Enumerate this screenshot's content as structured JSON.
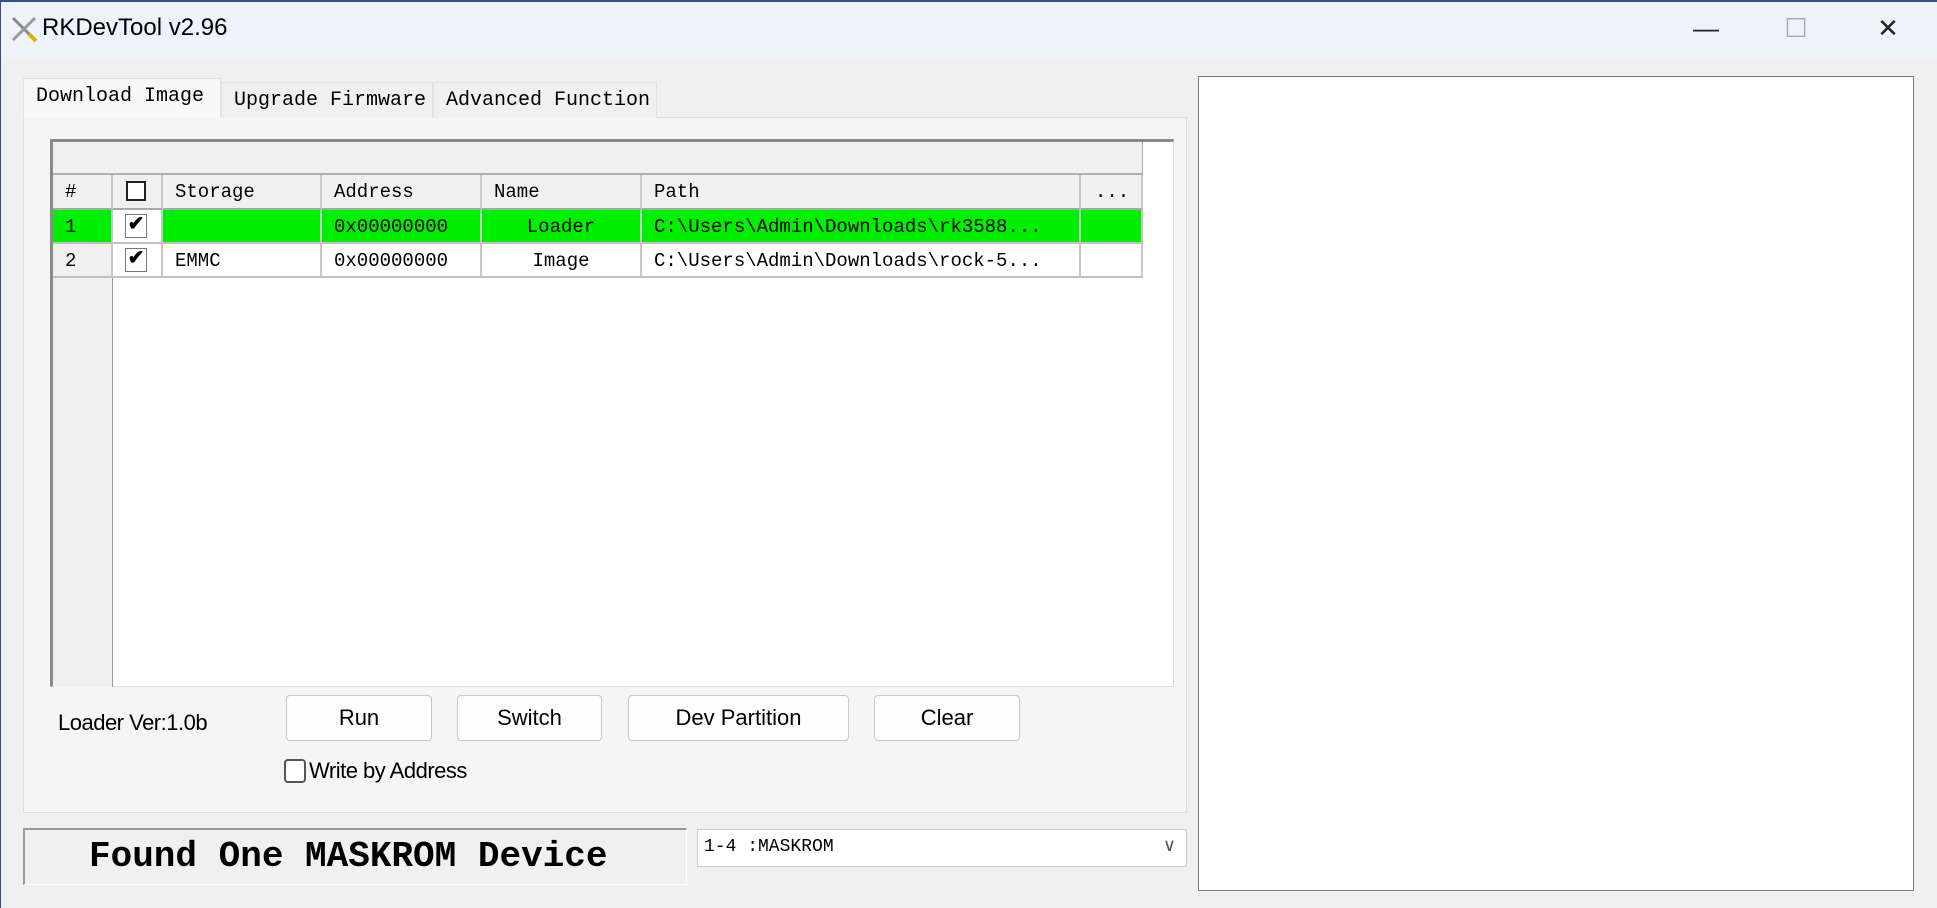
{
  "window": {
    "title": "RKDevTool v2.96",
    "controls": [
      "minimize-icon",
      "maximize-icon",
      "close-icon"
    ]
  },
  "tabs": [
    {
      "label": "Download Image",
      "active": true
    },
    {
      "label": "Upgrade Firmware"
    },
    {
      "label": "Advanced Function"
    }
  ],
  "table": {
    "columns": [
      "#",
      "",
      "Storage",
      "Address",
      "Name",
      "Path",
      "..."
    ],
    "rows": [
      {
        "num": "1",
        "checked": true,
        "storage": "",
        "address": "0x00000000",
        "name": "Loader",
        "path": "C:\\Users\\Admin\\Downloads\\rk3588...",
        "highlight": "#00ee00"
      },
      {
        "num": "2",
        "checked": true,
        "storage": "EMMC",
        "address": "0x00000000",
        "name": "Image",
        "path": "C:\\Users\\Admin\\Downloads\\rock-5..."
      }
    ]
  },
  "loader_ver": "Loader Ver:1.0b",
  "buttons": {
    "run": "Run",
    "switch": "Switch",
    "dev_partition": "Dev Partition",
    "clear": "Clear"
  },
  "write_by_address": {
    "label": "Write by Address",
    "checked": false
  },
  "status": "Found One MASKROM Device",
  "device_select": {
    "value": "1-4 :MASKROM"
  },
  "check_mark": "✔"
}
